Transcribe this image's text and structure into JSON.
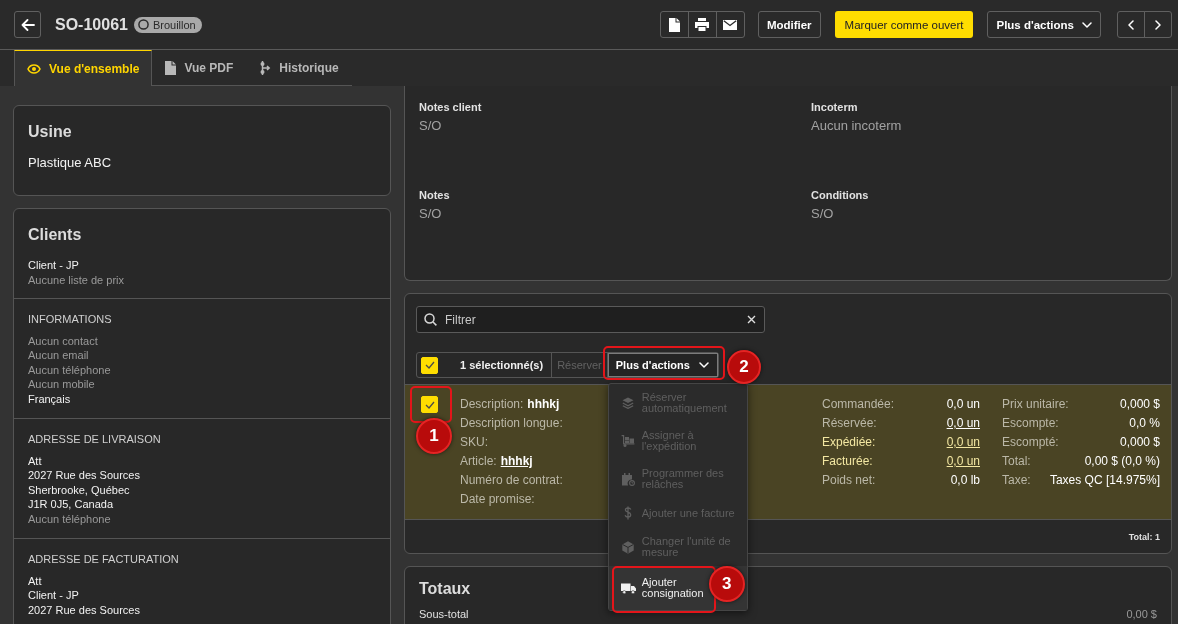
{
  "header": {
    "title": "SO-10061",
    "status": {
      "label": "Brouillon"
    },
    "actions": [
      {
        "label": "Modifier",
        "kind": "outline"
      },
      {
        "label": "Marquer comme ouvert",
        "kind": "primary"
      },
      {
        "label": "Plus d'actions",
        "kind": "dropdown"
      }
    ]
  },
  "tabs": [
    {
      "label": "Vue d'ensemble",
      "selected": true
    },
    {
      "label": "Vue PDF",
      "selected": false
    },
    {
      "label": "Historique",
      "selected": false
    }
  ],
  "plant": {
    "title": "Usine",
    "value": "Plastique ABC"
  },
  "clients": {
    "title": "Clients",
    "name": "Client - JP",
    "price_list": "Aucune liste de prix",
    "sections": [
      {
        "heading": "INFORMATIONS",
        "lines": [
          {
            "text": "Aucun contact",
            "muted": true
          },
          {
            "text": "Aucun email",
            "muted": true
          },
          {
            "text": "Aucun téléphone",
            "muted": true
          },
          {
            "text": "Aucun mobile",
            "muted": true
          },
          {
            "text": "Français",
            "muted": false
          }
        ]
      },
      {
        "heading": "ADRESSE DE LIVRAISON",
        "lines": [
          {
            "text": "Att",
            "muted": false
          },
          {
            "text": "2027 Rue des Sources",
            "muted": false
          },
          {
            "text": "Sherbrooke, Québec",
            "muted": false
          },
          {
            "text": "J1R 0J5, Canada",
            "muted": false
          },
          {
            "text": "Aucun téléphone",
            "muted": true
          }
        ]
      },
      {
        "heading": "ADRESSE DE FACTURATION",
        "lines": [
          {
            "text": "Att",
            "muted": false
          },
          {
            "text": "Client - JP",
            "muted": false
          },
          {
            "text": "2027 Rue des Sources",
            "muted": false
          }
        ]
      }
    ]
  },
  "details": {
    "fields": [
      {
        "label": "Notes client",
        "value": "S/O"
      },
      {
        "label": "Incoterm",
        "value": "Aucun incoterm"
      },
      {
        "label": "Notes",
        "value": "S/O"
      },
      {
        "label": "Conditions",
        "value": "S/O"
      }
    ]
  },
  "lines": {
    "filter": {
      "placeholder": "Filtrer"
    },
    "toolbar": {
      "select_all": {
        "checked": true
      },
      "count": "1 sélectionné(s)",
      "reserve": {
        "label": "Réserver",
        "disabled": true
      },
      "more": {
        "label": "Plus d'actions",
        "expanded": true,
        "callout": "2"
      }
    },
    "menu": [
      {
        "label": "Réserver automatiquement",
        "disabled": true,
        "highlighted": false
      },
      {
        "label": "Assigner à l'expédition",
        "disabled": true,
        "highlighted": false
      },
      {
        "label": "Programmer des relâches",
        "disabled": true,
        "highlighted": false
      },
      {
        "label": "Ajouter une facture",
        "disabled": true,
        "highlighted": false
      },
      {
        "label": "Changer l'unité de mesure",
        "disabled": true,
        "highlighted": false
      },
      {
        "label": "Ajouter consignation",
        "disabled": false,
        "highlighted": true,
        "callout": "3"
      }
    ],
    "rows": [
      {
        "selected": true,
        "checkbox": {
          "checked": true,
          "callout": "1"
        },
        "details": [
          {
            "label": "Description:",
            "value": "hhhkj",
            "kind": "text"
          },
          {
            "label": "Description longue:",
            "kind": "blank"
          },
          {
            "label": "SKU:",
            "kind": "blank"
          },
          {
            "label": "Article:",
            "value": "hhhkj",
            "kind": "link"
          },
          {
            "label": "Numéro de contrat:",
            "kind": "blank"
          },
          {
            "label": "Date promise:",
            "kind": "blank"
          }
        ],
        "quantities": [
          {
            "label": "Commandée:",
            "value": "0,0 un",
            "link": false,
            "emphasized": false
          },
          {
            "label": "Réservée:",
            "value": "0,0 un",
            "link": true,
            "emphasized": false
          },
          {
            "label": "Expédiée:",
            "value": "0,0 un",
            "link": true,
            "emphasized": true
          },
          {
            "label": "Facturée:",
            "value": "0,0 un",
            "link": true,
            "emphasized": true
          },
          {
            "label": "Poids net:",
            "value": "0,0 lb",
            "link": false,
            "emphasized": false
          }
        ],
        "pricing": [
          {
            "label": "Prix unitaire:",
            "value": "0,000 $"
          },
          {
            "label": "Escompte:",
            "value": "0,0 %"
          },
          {
            "label": "Escompté:",
            "value": "0,000 $"
          },
          {
            "label": "Total:",
            "value": "0,00 $ (0,0 %)"
          },
          {
            "label": "Taxe:",
            "value": "Taxes QC [14.975%]"
          }
        ]
      }
    ],
    "footer": "Total: 1"
  },
  "totals": {
    "title": "Totaux",
    "rows": [
      {
        "label": "Sous-total",
        "value": "0,00 $"
      }
    ]
  }
}
